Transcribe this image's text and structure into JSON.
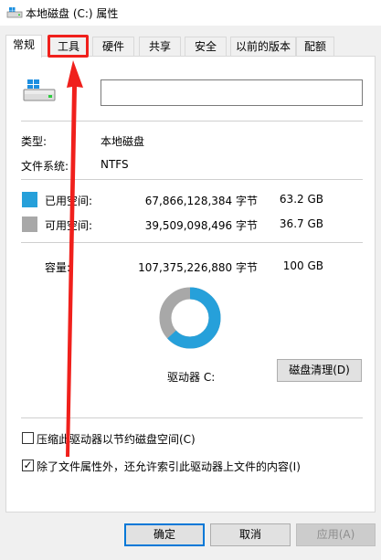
{
  "window": {
    "title": "本地磁盘 (C:) 属性"
  },
  "tabs": [
    {
      "label": "常规",
      "active": true
    },
    {
      "label": "工具",
      "active": false
    },
    {
      "label": "硬件",
      "active": false
    },
    {
      "label": "共享",
      "active": false
    },
    {
      "label": "安全",
      "active": false
    },
    {
      "label": "以前的版本",
      "active": false
    },
    {
      "label": "配额",
      "active": false
    }
  ],
  "general": {
    "drive_name_value": "",
    "type_label": "类型:",
    "type_value": "本地磁盘",
    "fs_label": "文件系统:",
    "fs_value": "NTFS",
    "used": {
      "label": "已用空间:",
      "bytes": "67,866,128,384 字节",
      "size": "63.2 GB",
      "color": "#26a0da"
    },
    "free": {
      "label": "可用空间:",
      "bytes": "39,509,098,496 字节",
      "size": "36.7 GB",
      "color": "#a8a8a8"
    },
    "capacity": {
      "label": "容量:",
      "bytes": "107,375,226,880 字节",
      "size": "100 GB"
    },
    "used_fraction": 0.632,
    "drive_label": "驱动器 C:",
    "cleanup_button": "磁盘清理(D)"
  },
  "options": {
    "compress_label": "压缩此驱动器以节约磁盘空间(C)",
    "compress_checked": false,
    "index_label": "除了文件属性外，还允许索引此驱动器上文件的内容(I)",
    "index_checked": true
  },
  "footer": {
    "ok": "确定",
    "cancel": "取消",
    "apply": "应用(A)"
  },
  "colors": {
    "annotation": "#f0201c",
    "accent": "#0078d7"
  }
}
